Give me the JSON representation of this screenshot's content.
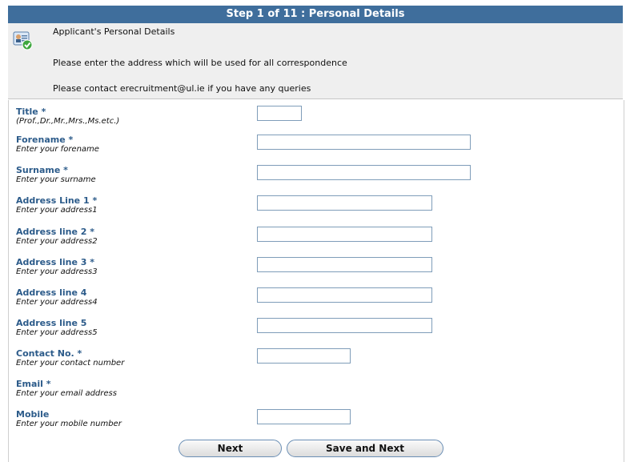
{
  "header": {
    "title": "Step 1 of 11 : Personal Details"
  },
  "info": {
    "heading": "Applicant's Personal Details",
    "line1": "Please enter the address which will be used for all correspondence",
    "line2": "Please contact erecruitment@ul.ie if you have any queries",
    "icon": "applicant-card-check-icon"
  },
  "fields": [
    {
      "label": "Title *",
      "hint": "(Prof.,Dr.,Mr.,Mrs.,Ms.etc.)",
      "value": ""
    },
    {
      "label": "Forename *",
      "hint": "Enter your forename",
      "value": ""
    },
    {
      "label": "Surname *",
      "hint": "Enter your surname",
      "value": ""
    },
    {
      "label": "Address Line 1 *",
      "hint": "Enter your address1",
      "value": ""
    },
    {
      "label": "Address line 2 *",
      "hint": "Enter your address2",
      "value": ""
    },
    {
      "label": "Address line 3 *",
      "hint": "Enter your address3",
      "value": ""
    },
    {
      "label": "Address line 4",
      "hint": "Enter your address4",
      "value": ""
    },
    {
      "label": "Address line 5",
      "hint": "Enter your address5",
      "value": ""
    },
    {
      "label": "Contact No. *",
      "hint": "Enter your contact number",
      "value": ""
    },
    {
      "label": "Email *",
      "hint": "Enter your email address",
      "value": ""
    },
    {
      "label": "Mobile",
      "hint": "Enter your mobile number",
      "value": ""
    }
  ],
  "buttons": {
    "next": "Next",
    "save_next": "Save and Next"
  },
  "colors": {
    "accent": "#3f6e9c",
    "label": "#2c5b8a"
  }
}
